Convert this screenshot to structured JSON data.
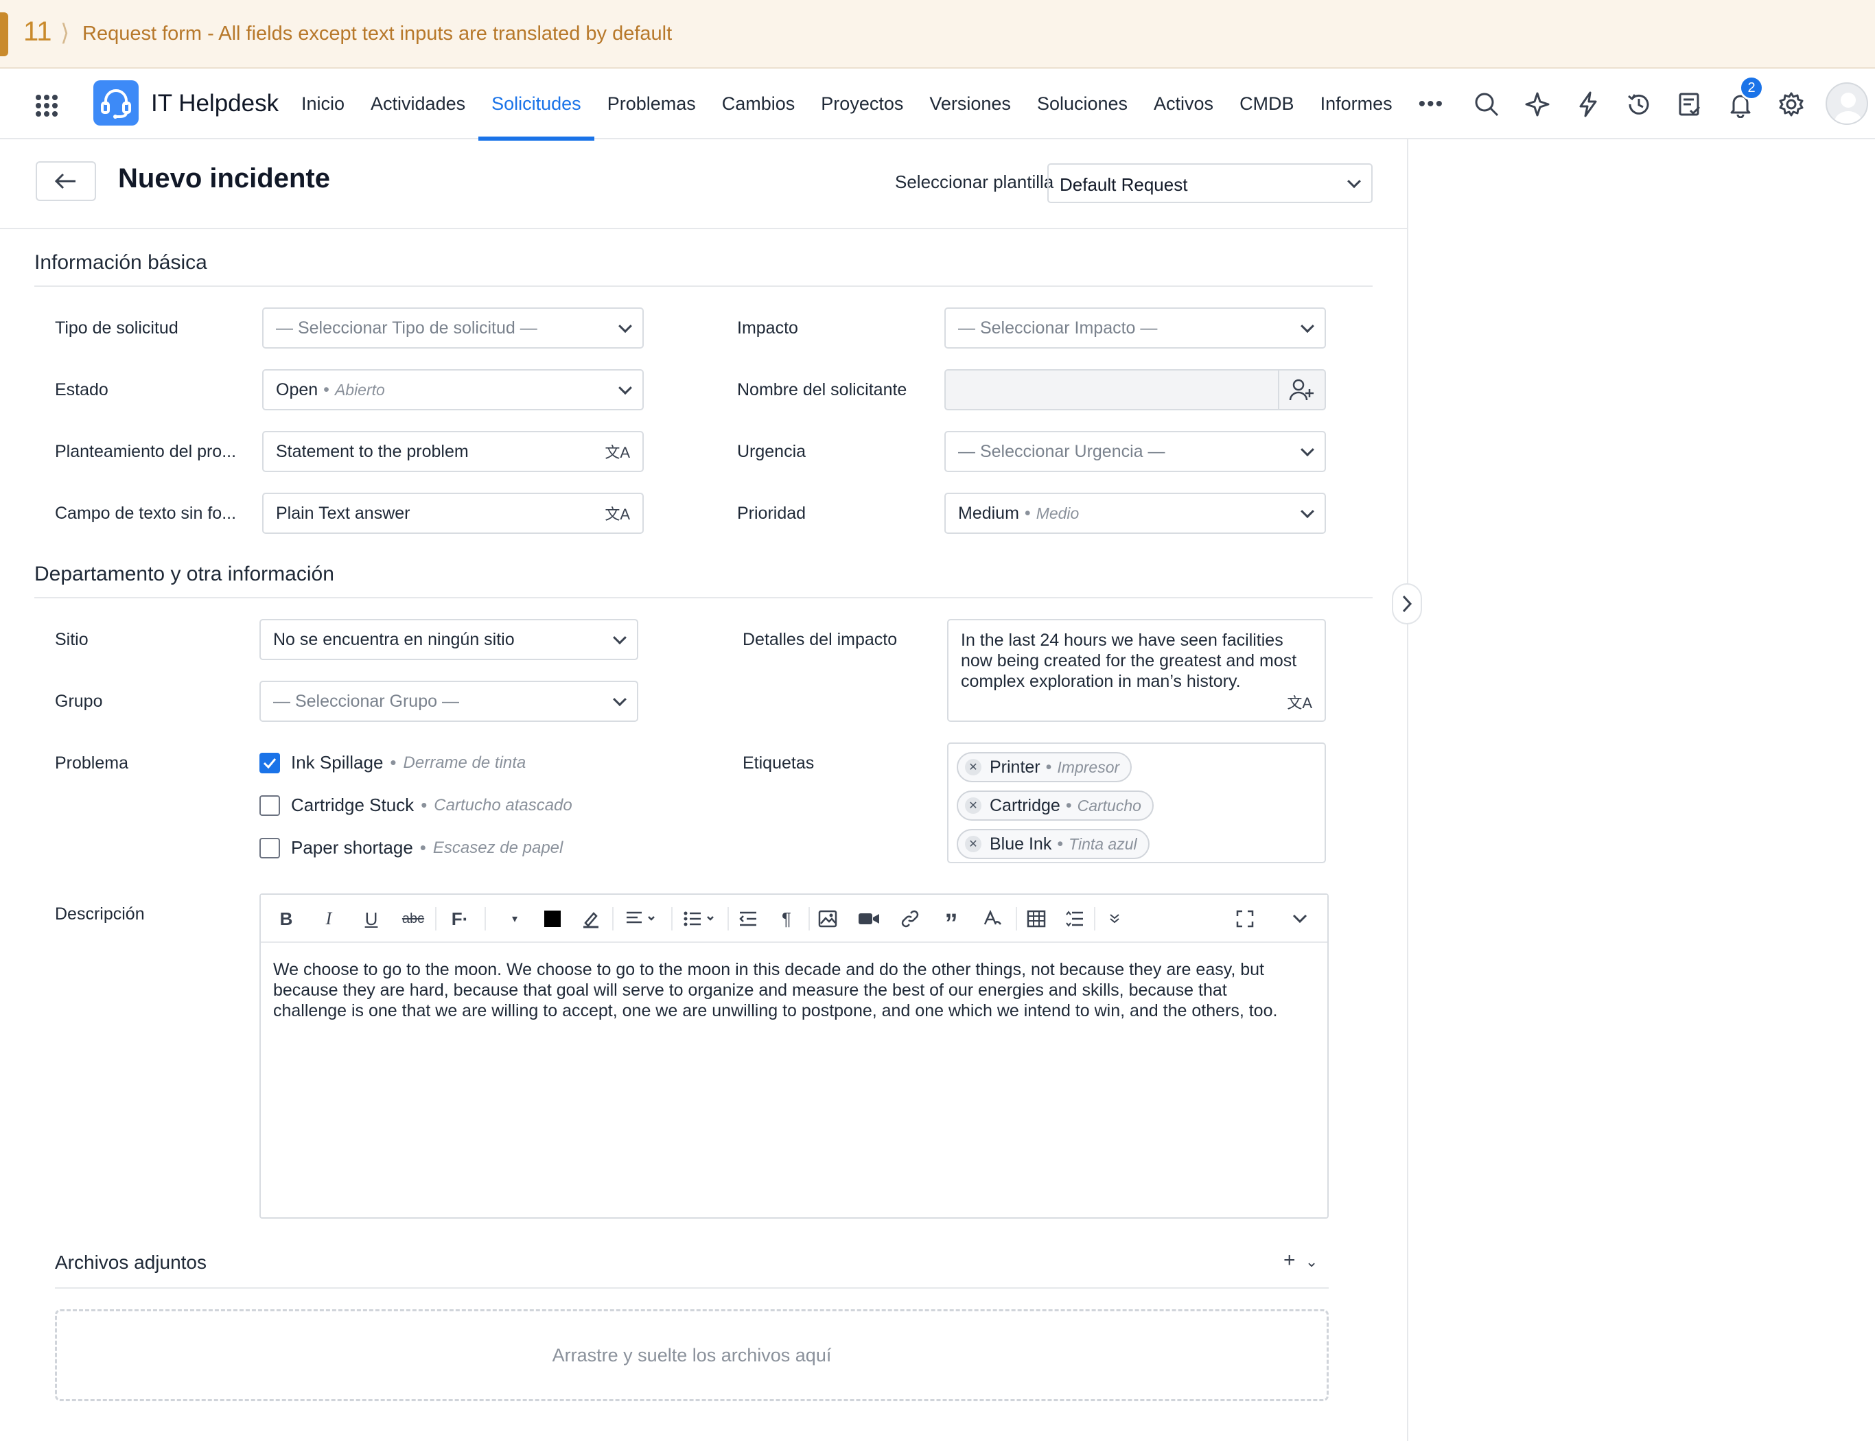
{
  "banner": {
    "number": "11",
    "text": "Request form - All fields except text inputs are translated by default"
  },
  "nav": {
    "app_title": "IT Helpdesk",
    "tabs": [
      {
        "label": "Inicio",
        "active": false
      },
      {
        "label": "Actividades",
        "active": false
      },
      {
        "label": "Solicitudes",
        "active": true
      },
      {
        "label": "Problemas",
        "active": false
      },
      {
        "label": "Cambios",
        "active": false
      },
      {
        "label": "Proyectos",
        "active": false
      },
      {
        "label": "Versiones",
        "active": false
      },
      {
        "label": "Soluciones",
        "active": false
      },
      {
        "label": "Activos",
        "active": false
      },
      {
        "label": "CMDB",
        "active": false
      },
      {
        "label": "Informes",
        "active": false
      }
    ],
    "more": "•••",
    "notification_count": "2",
    "icons": [
      "search-icon",
      "ai-sparkle-icon",
      "bolt-icon",
      "history-icon",
      "tasks-icon",
      "bell-icon",
      "gear-icon"
    ]
  },
  "header": {
    "title": "Nuevo incidente",
    "template_label": "Seleccionar plantilla",
    "template_value": "Default Request"
  },
  "section_basic": {
    "title": "Información básica",
    "request_type": {
      "label": "Tipo de solicitud",
      "placeholder": "— Seleccionar Tipo de solicitud —"
    },
    "status": {
      "label": "Estado",
      "value": "Open",
      "translation": "Abierto"
    },
    "problem_statement": {
      "label": "Planteamiento del pro...",
      "value": "Statement to the problem"
    },
    "plain_text": {
      "label": "Campo de texto sin fo...",
      "value": "Plain Text answer"
    },
    "impact": {
      "label": "Impacto",
      "placeholder": "— Seleccionar Impacto —"
    },
    "requester": {
      "label": "Nombre del solicitante",
      "value": ""
    },
    "urgency": {
      "label": "Urgencia",
      "placeholder": "— Seleccionar Urgencia —"
    },
    "priority": {
      "label": "Prioridad",
      "value": "Medium",
      "translation": "Medio"
    }
  },
  "section_dept": {
    "title": "Departamento y otra información",
    "site": {
      "label": "Sitio",
      "value": "No se encuentra en ningún sitio"
    },
    "group": {
      "label": "Grupo",
      "placeholder": "— Seleccionar Grupo —"
    },
    "problem": {
      "label": "Problema",
      "options": [
        {
          "value": "Ink Spillage",
          "translation": "Derrame de tinta",
          "checked": true
        },
        {
          "value": "Cartridge Stuck",
          "translation": "Cartucho atascado",
          "checked": false
        },
        {
          "value": "Paper shortage",
          "translation": "Escasez de papel",
          "checked": false
        }
      ]
    },
    "impact_details": {
      "label": "Detalles del impacto",
      "value": "In the last 24 hours we have seen facilities now being created for the greatest and most complex exploration in man’s history."
    },
    "tags": {
      "label": "Etiquetas",
      "items": [
        {
          "value": "Printer",
          "translation": "Impresor"
        },
        {
          "value": "Cartridge",
          "translation": "Cartucho"
        },
        {
          "value": "Blue Ink",
          "translation": "Tinta azul"
        }
      ]
    }
  },
  "description": {
    "label": "Descripción",
    "body": "We choose to go to the moon. We choose to go to the moon in this decade and do the other things, not because they are easy, but because they are hard, because that goal will serve to organize and measure the best of our energies and skills, because that challenge is one that we are willing to accept, one we are unwilling to postpone, and one which we intend to win, and the others, too."
  },
  "attachments": {
    "title": "Archivos adjuntos",
    "dropzone": "Arrastre y suelte los archivos aquí"
  },
  "colors": {
    "accent": "#1a73e8",
    "banner_bg": "#fbf4ea",
    "banner_text": "#b7782a",
    "logo": "#3d8af7"
  }
}
